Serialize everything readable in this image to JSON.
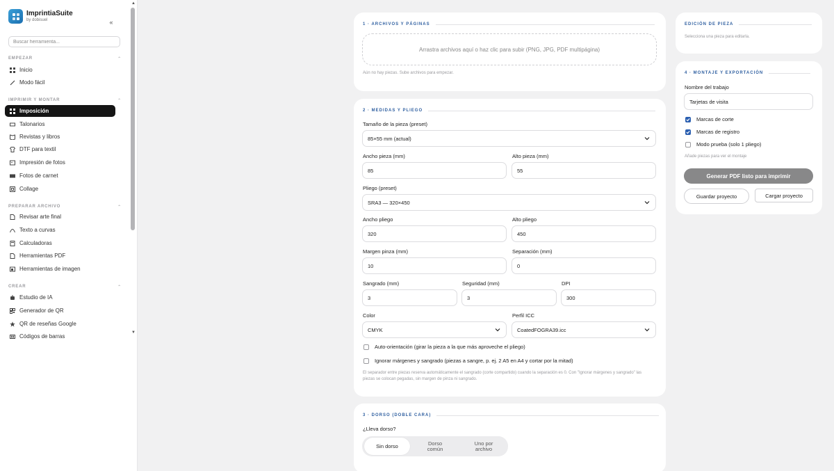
{
  "app": {
    "name": "ImprintiaSuite",
    "byline": "by dobisuel"
  },
  "sidebar": {
    "search_placeholder": "Buscar herramienta...",
    "sections": [
      {
        "title": "EMPEZAR",
        "items": [
          {
            "label": "Inicio",
            "icon": "grid-icon"
          },
          {
            "label": "Modo fácil",
            "icon": "wand-icon"
          }
        ]
      },
      {
        "title": "IMPRIMIR Y MONTAR",
        "items": [
          {
            "label": "Imposición",
            "icon": "grid-icon",
            "active": true
          },
          {
            "label": "Talonarios",
            "icon": "ticket-icon"
          },
          {
            "label": "Revistas y libros",
            "icon": "book-icon"
          },
          {
            "label": "DTF para textil",
            "icon": "shirt-icon"
          },
          {
            "label": "Impresión de fotos",
            "icon": "image-icon"
          },
          {
            "label": "Fotos de carnet",
            "icon": "id-card-icon"
          },
          {
            "label": "Collage",
            "icon": "collage-icon"
          }
        ]
      },
      {
        "title": "PREPARAR ARCHIVO",
        "items": [
          {
            "label": "Revisar arte final",
            "icon": "file-check-icon"
          },
          {
            "label": "Texto a curvas",
            "icon": "curve-icon"
          },
          {
            "label": "Calculadoras",
            "icon": "calculator-icon"
          },
          {
            "label": "Herramientas PDF",
            "icon": "pdf-icon"
          },
          {
            "label": "Herramientas de imagen",
            "icon": "image-tools-icon"
          }
        ]
      },
      {
        "title": "CREAR",
        "items": [
          {
            "label": "Estudio de IA",
            "icon": "robot-icon"
          },
          {
            "label": "Generador de QR",
            "icon": "qr-icon"
          },
          {
            "label": "QR de reseñas Google",
            "icon": "star-icon"
          },
          {
            "label": "Códigos de barras",
            "icon": "barcode-icon"
          }
        ]
      }
    ]
  },
  "archivos": {
    "title": "1 · ARCHIVOS Y PÁGINAS",
    "dropzone": "Arrastra archivos aquí o haz clic para subir (PNG, JPG, PDF multipágina)",
    "empty": "Aún no hay piezas. Sube archivos para empezar."
  },
  "medidas": {
    "title": "2 · MEDIDAS Y PLIEGO",
    "size_preset_label": "Tamaño de la pieza (preset)",
    "size_preset_value": "85×55 mm (actual)",
    "ancho_pieza_label": "Ancho pieza (mm)",
    "ancho_pieza": "85",
    "alto_pieza_label": "Alto pieza (mm)",
    "alto_pieza": "55",
    "pliego_preset_label": "Pliego (preset)",
    "pliego_preset_value": "SRA3 — 320×450",
    "ancho_pliego_label": "Ancho pliego",
    "ancho_pliego": "320",
    "alto_pliego_label": "Alto pliego",
    "alto_pliego": "450",
    "margen_pinza_label": "Margen pinza (mm)",
    "margen_pinza": "10",
    "separacion_label": "Separación (mm)",
    "separacion": "0",
    "sangrado_label": "Sangrado (mm)",
    "sangrado": "3",
    "seguridad_label": "Seguridad (mm)",
    "seguridad": "3",
    "dpi_label": "DPI",
    "dpi": "300",
    "color_label": "Color",
    "color": "CMYK",
    "icc_label": "Perfil ICC",
    "icc": "CoatedFOGRA39.icc",
    "auto_orient": "Auto-orientación (girar la pieza a la que más aproveche el pliego)",
    "ignore_margins": "Ignorar márgenes y sangrado (piezas a sangre, p. ej. 2 A5 en A4 y cortar por la mitad)",
    "note": "El separador entre piezas reserva automáticamente el sangrado (corte compartido) cuando la separación es 0. Con \"Ignorar márgenes y sangrado\" las piezas se colocan pegadas, sin margen de pinza ni sangrado."
  },
  "dorso": {
    "title": "3 · DORSO (DOBLE CARA)",
    "question": "¿Lleva dorso?",
    "options": [
      "Sin dorso",
      "Dorso común",
      "Uno por archivo"
    ]
  },
  "edicion": {
    "title": "EDICIÓN DE PIEZA",
    "hint": "Selecciona una pieza para editarla."
  },
  "montaje": {
    "title": "4 · MONTAJE Y EXPORTACIÓN",
    "job_label": "Nombre del trabajo",
    "job_value": "Tarjetas de visita",
    "marcas_corte": "Marcas de corte",
    "marcas_registro": "Marcas de registro",
    "modo_prueba": "Modo prueba (solo 1 pliego)",
    "hint": "Añade piezas para ver el montaje",
    "generate": "Generar PDF listo para imprimir",
    "save": "Guardar proyecto",
    "load": "Cargar proyecto"
  },
  "colors": {
    "accent": "#2f5fa0",
    "active_nav": "#151515",
    "checkbox": "#2b5fb0"
  }
}
